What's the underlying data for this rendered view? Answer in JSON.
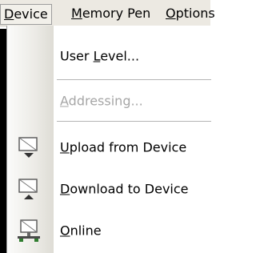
{
  "menubar": {
    "device": {
      "pre": "",
      "ul": "D",
      "post": "evice"
    },
    "memory_pen": {
      "pre": "",
      "ul": "M",
      "post": "emory Pen"
    },
    "options": {
      "pre": "",
      "ul": "O",
      "post": "ptions"
    }
  },
  "dropdown": {
    "user_level": {
      "pre": "User ",
      "ul": "L",
      "post": "evel..."
    },
    "addressing": {
      "pre": "",
      "ul": "A",
      "post": "ddressing..."
    },
    "upload": {
      "pre": "",
      "ul": "U",
      "post": "pload from Device",
      "icon": "upload-device-icon"
    },
    "download": {
      "pre": "",
      "ul": "D",
      "post": "ownload to Device",
      "icon": "download-device-icon"
    },
    "online": {
      "pre": "",
      "ul": "O",
      "post": "nline",
      "icon": "online-network-icon"
    }
  }
}
